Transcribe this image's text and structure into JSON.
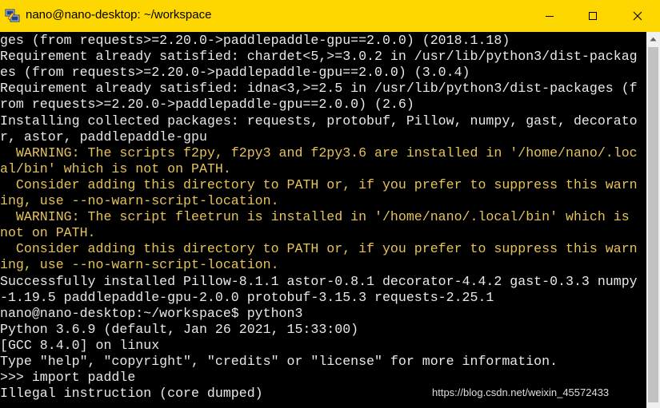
{
  "window": {
    "title": "nano@nano-desktop: ~/workspace",
    "titlebar_color": "#FFD700",
    "controls": [
      "minimize-icon",
      "maximize-icon",
      "close-icon"
    ]
  },
  "terminal": {
    "background": "#000000",
    "text_color": "#E8E8E8",
    "warning_color": "#E5C35A",
    "lines": [
      {
        "text": "ges (from requests>=2.20.0->paddlepaddle-gpu==2.0.0) (2018.1.18)",
        "style": "normal"
      },
      {
        "text": "Requirement already satisfied: chardet<5,>=3.0.2 in /usr/lib/python3/dist-packag",
        "style": "normal"
      },
      {
        "text": "es (from requests>=2.20.0->paddlepaddle-gpu==2.0.0) (3.0.4)",
        "style": "normal"
      },
      {
        "text": "Requirement already satisfied: idna<3,>=2.5 in /usr/lib/python3/dist-packages (f",
        "style": "normal"
      },
      {
        "text": "rom requests>=2.20.0->paddlepaddle-gpu==2.0.0) (2.6)",
        "style": "normal"
      },
      {
        "text": "Installing collected packages: requests, protobuf, Pillow, numpy, gast, decorato",
        "style": "normal"
      },
      {
        "text": "r, astor, paddlepaddle-gpu",
        "style": "normal"
      },
      {
        "text": "  WARNING: The scripts f2py, f2py3 and f2py3.6 are installed in '/home/nano/.loc",
        "style": "warn"
      },
      {
        "text": "al/bin' which is not on PATH.",
        "style": "warn"
      },
      {
        "text": "  Consider adding this directory to PATH or, if you prefer to suppress this warn",
        "style": "warn"
      },
      {
        "text": "ing, use --no-warn-script-location.",
        "style": "warn"
      },
      {
        "text": "  WARNING: The script fleetrun is installed in '/home/nano/.local/bin' which is",
        "style": "warn"
      },
      {
        "text": "not on PATH.",
        "style": "warn"
      },
      {
        "text": "  Consider adding this directory to PATH or, if you prefer to suppress this warn",
        "style": "warn"
      },
      {
        "text": "ing, use --no-warn-script-location.",
        "style": "warn"
      },
      {
        "text": "Successfully installed Pillow-8.1.1 astor-0.8.1 decorator-4.4.2 gast-0.3.3 numpy",
        "style": "normal"
      },
      {
        "text": "-1.19.5 paddlepaddle-gpu-2.0.0 protobuf-3.15.3 requests-2.25.1",
        "style": "normal"
      },
      {
        "text": "nano@nano-desktop:~/workspace$ python3",
        "style": "normal"
      },
      {
        "text": "Python 3.6.9 (default, Jan 26 2021, 15:33:00)",
        "style": "normal"
      },
      {
        "text": "[GCC 8.4.0] on linux",
        "style": "normal"
      },
      {
        "text": "Type \"help\", \"copyright\", \"credits\" or \"license\" for more information.",
        "style": "normal"
      },
      {
        "text": ">>> import paddle",
        "style": "normal"
      },
      {
        "text": "Illegal instruction (core dumped)",
        "style": "normal"
      }
    ]
  },
  "scrollbar": {
    "up_arrow_icon": "triangle-up-icon"
  },
  "watermark": {
    "text": "https://blog.csdn.net/weixin_45572433"
  }
}
